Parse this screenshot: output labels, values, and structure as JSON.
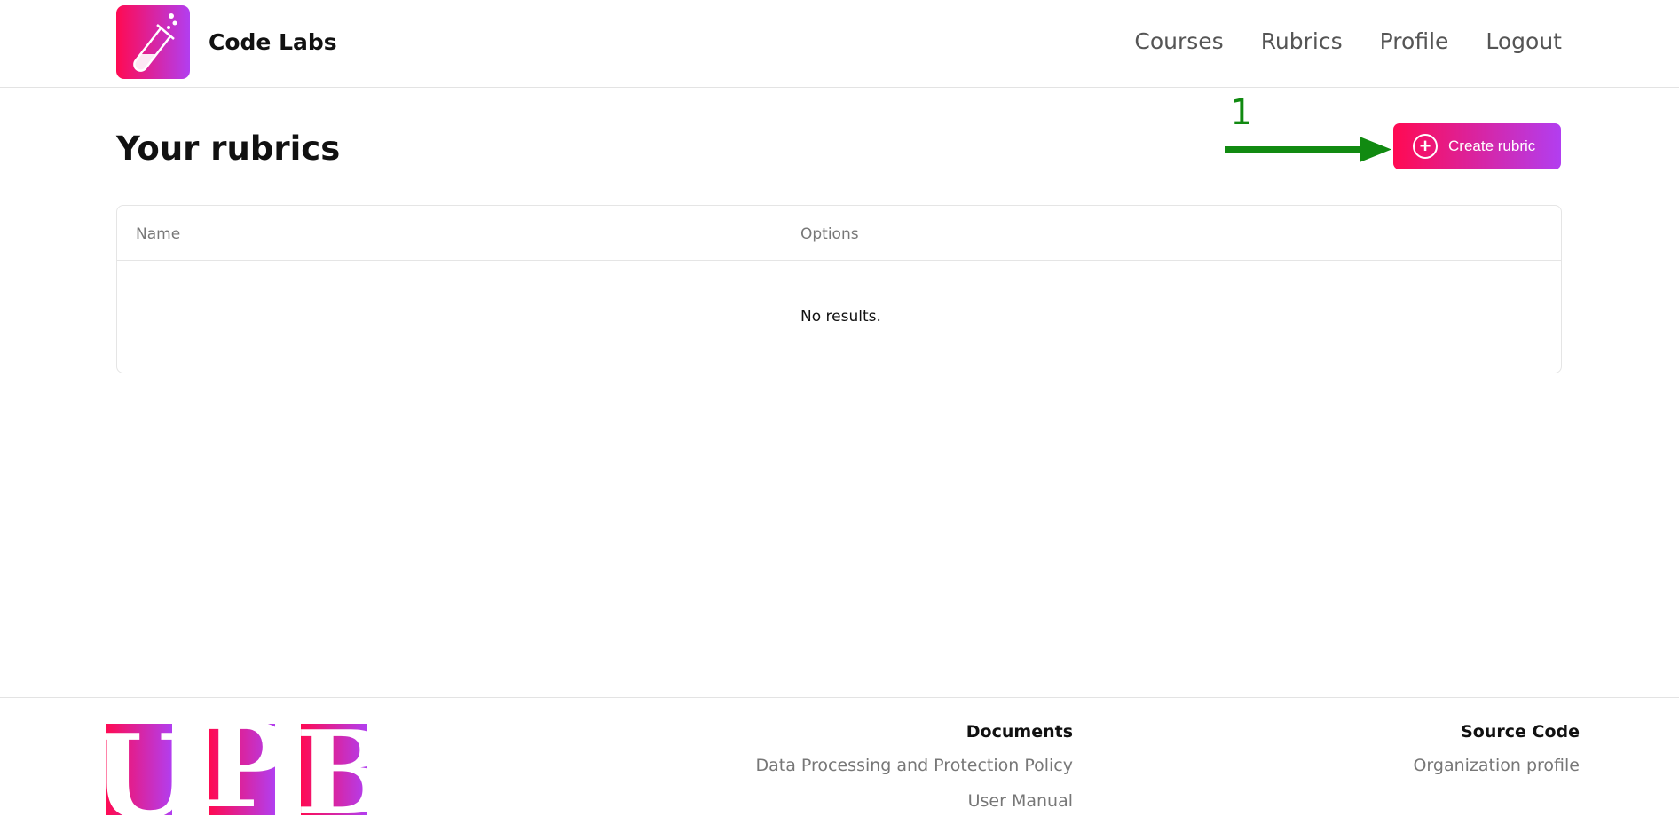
{
  "header": {
    "brand": "Code Labs",
    "logo_icon": "test-tube-icon",
    "nav": [
      {
        "label": "Courses"
      },
      {
        "label": "Rubrics"
      },
      {
        "label": "Profile"
      },
      {
        "label": "Logout"
      }
    ]
  },
  "main": {
    "title": "Your rubrics",
    "create_button": "Create rubric",
    "create_icon": "plus-circle-icon",
    "table": {
      "columns": [
        "Name",
        "Options"
      ],
      "empty_text": "No results."
    }
  },
  "annotation": {
    "number": "1",
    "color": "#118a11"
  },
  "footer": {
    "logo_text": "UPB",
    "documents": {
      "heading": "Documents",
      "links": [
        "Data Processing and Protection Policy",
        "User Manual"
      ]
    },
    "source": {
      "heading": "Source Code",
      "links": [
        "Organization profile"
      ]
    }
  },
  "colors": {
    "gradient_start": "#ff0a52",
    "gradient_end": "#b23ef0"
  }
}
